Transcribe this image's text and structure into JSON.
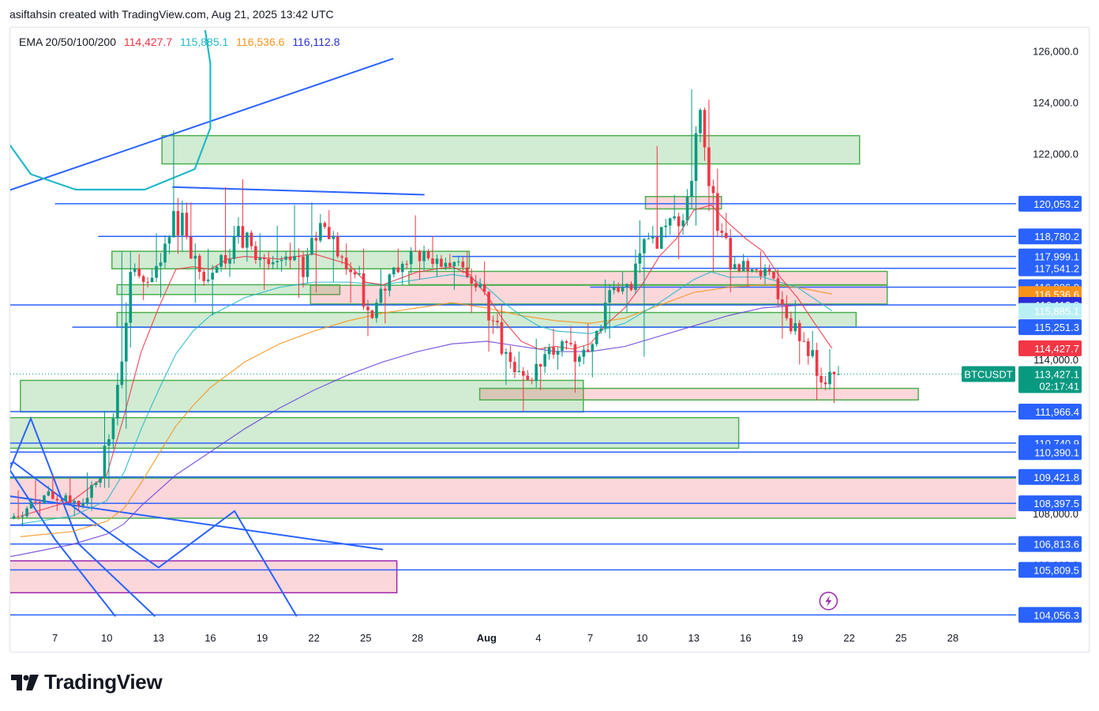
{
  "header": {
    "attribution": "asiftahsin created with TradingView.com, Aug 21, 2025 13:42 UTC"
  },
  "ema": {
    "label": "EMA 20/50/100/200",
    "values": [
      {
        "name": "EMA 20",
        "value": "114,427.7",
        "color": "#f23645"
      },
      {
        "name": "EMA 50",
        "value": "115,885.1",
        "color": "#22b8c8"
      },
      {
        "name": "EMA 100",
        "value": "116,536.6",
        "color": "#f7931a"
      },
      {
        "name": "EMA 200",
        "value": "116,112.8",
        "color": "#2a2ed6"
      }
    ]
  },
  "brand": {
    "name": "TradingView"
  },
  "chart_data": {
    "type": "candlestick",
    "symbol": "BTCUSDT",
    "countdown": "02:17:41",
    "last_price": 113427.1,
    "ylim": [
      103700,
      126900
    ],
    "x_ticks": [
      {
        "label": "7",
        "day": 7
      },
      {
        "label": "10",
        "day": 10
      },
      {
        "label": "13",
        "day": 13
      },
      {
        "label": "16",
        "day": 16
      },
      {
        "label": "19",
        "day": 19
      },
      {
        "label": "22",
        "day": 22
      },
      {
        "label": "25",
        "day": 25
      },
      {
        "label": "28",
        "day": 28
      },
      {
        "label": "Aug",
        "day": 32
      },
      {
        "label": "4",
        "day": 35
      },
      {
        "label": "7",
        "day": 38
      },
      {
        "label": "10",
        "day": 41
      },
      {
        "label": "13",
        "day": 44
      },
      {
        "label": "16",
        "day": 47
      },
      {
        "label": "19",
        "day": 50
      },
      {
        "label": "22",
        "day": 53
      },
      {
        "label": "25",
        "day": 56
      },
      {
        "label": "28",
        "day": 59
      }
    ],
    "y_ticks": [
      {
        "value": 126000,
        "label": "126,000.0"
      },
      {
        "value": 124000,
        "label": "124,000.0"
      },
      {
        "value": 122000,
        "label": "122,000.0"
      },
      {
        "value": 114000,
        "label": "114,000.0"
      },
      {
        "value": 108000,
        "label": "108,000.0"
      },
      {
        "value": 106000,
        "label": "106,000.0"
      }
    ],
    "price_levels": [
      {
        "value": 120053.2,
        "label": "120,053.2",
        "start_day": 7
      },
      {
        "value": 118780.2,
        "label": "118,780.2",
        "start_day": 9.5
      },
      {
        "value": 117999.1,
        "label": "117,999.1",
        "start_day": 30
      },
      {
        "value": 117541.2,
        "label": "117,541.2",
        "start_day": 41
      },
      {
        "value": 116806.0,
        "label": "116,806.0",
        "start_day": 38
      },
      {
        "value": 116112.8,
        "label": "116,112.8",
        "start_day": 3
      },
      {
        "value": 115251.3,
        "label": "115,251.3",
        "start_day": 8
      },
      {
        "value": 111966.4,
        "label": "111,966.4",
        "start_day": 4
      },
      {
        "value": 110740.9,
        "label": "110,740.9",
        "start_day": 1
      },
      {
        "value": 110390.1,
        "label": "110,390.1",
        "start_day": 1
      },
      {
        "value": 109421.8,
        "label": "109,421.8",
        "start_day": 1
      },
      {
        "value": 108397.5,
        "label": "108,397.5",
        "start_day": 1
      },
      {
        "value": 106813.6,
        "label": "106,813.6",
        "start_day": 1
      },
      {
        "value": 105809.5,
        "label": "105,809.5",
        "start_day": 1
      },
      {
        "value": 104056.3,
        "label": "104,056.3",
        "start_day": 1
      }
    ],
    "tags": [
      {
        "value": 116536.6,
        "label": "116,536.6",
        "color": "#f7931a"
      },
      {
        "value": 116112.8,
        "label": "116,112.8",
        "color": "#2a2ed6"
      },
      {
        "value": 115885.1,
        "label": "115,885.1",
        "color": "#b9f0f5",
        "text": "#131722"
      },
      {
        "value": 114427.7,
        "label": "114,427.7",
        "color": "#f23645"
      }
    ],
    "zones": [
      {
        "x0": 13.2,
        "x1": 53.6,
        "y0": 121600,
        "y1": 122700,
        "type": "demand"
      },
      {
        "x0": 10.3,
        "x1": 31.0,
        "y0": 117520,
        "y1": 118200,
        "type": "demand"
      },
      {
        "x0": 41.2,
        "x1": 45.6,
        "y0": 119850,
        "y1": 120330,
        "type": "supply"
      },
      {
        "x0": 27.5,
        "x1": 55.2,
        "y0": 116900,
        "y1": 117420,
        "type": "supply"
      },
      {
        "x0": 10.6,
        "x1": 23.5,
        "y0": 116520,
        "y1": 116900,
        "type": "demand"
      },
      {
        "x0": 21.8,
        "x1": 55.2,
        "y0": 116150,
        "y1": 116880,
        "type": "supply"
      },
      {
        "x0": 10.6,
        "x1": 53.4,
        "y0": 115250,
        "y1": 115820,
        "type": "demand"
      },
      {
        "x0": 5.0,
        "x1": 37.6,
        "y0": 111950,
        "y1": 113180,
        "type": "demand"
      },
      {
        "x0": 31.6,
        "x1": 57.0,
        "y0": 112420,
        "y1": 112870,
        "type": "supply"
      },
      {
        "x0": 1.0,
        "x1": 46.6,
        "y0": 110540,
        "y1": 111730,
        "type": "demand"
      },
      {
        "x0": 1.4,
        "x1": 64.5,
        "y0": 107820,
        "y1": 109380,
        "type": "supply"
      },
      {
        "x0": 1.0,
        "x1": 26.8,
        "y0": 104920,
        "y1": 106160,
        "type": "supply-purple"
      }
    ],
    "ohlc_days": [
      [
        5,
        107800,
        108900,
        107500,
        108200
      ],
      [
        6,
        108200,
        109300,
        107900,
        108700
      ],
      [
        7,
        108700,
        109500,
        108100,
        108500
      ],
      [
        8,
        108500,
        109400,
        107900,
        108300
      ],
      [
        9,
        108300,
        109600,
        108100,
        109200
      ],
      [
        10,
        109200,
        112000,
        109000,
        111700
      ],
      [
        11,
        111700,
        118200,
        111300,
        117400
      ],
      [
        12,
        117400,
        118100,
        116300,
        117000
      ],
      [
        13,
        117000,
        118900,
        116400,
        118500
      ],
      [
        14,
        118500,
        122900,
        118100,
        119700
      ],
      [
        15,
        119700,
        120100,
        116200,
        117400
      ],
      [
        16,
        117400,
        118300,
        115700,
        117600
      ],
      [
        17,
        117600,
        120700,
        117200,
        118800
      ],
      [
        18,
        118800,
        121000,
        117800,
        118400
      ],
      [
        19,
        118400,
        118900,
        116700,
        117700
      ],
      [
        20,
        117700,
        119200,
        117400,
        118000
      ],
      [
        21,
        118000,
        120000,
        116400,
        117200
      ],
      [
        22,
        117200,
        120100,
        116600,
        119300
      ],
      [
        23,
        119300,
        119800,
        117000,
        118000
      ],
      [
        24,
        118000,
        118500,
        116200,
        117300
      ],
      [
        25,
        117300,
        118300,
        114900,
        115600
      ],
      [
        26,
        115600,
        117500,
        115400,
        117300
      ],
      [
        27,
        117300,
        118300,
        116900,
        117700
      ],
      [
        28,
        117700,
        119600,
        117100,
        118200
      ],
      [
        29,
        118200,
        118800,
        117200,
        117600
      ],
      [
        30,
        117600,
        118100,
        116700,
        117800
      ],
      [
        31,
        117800,
        118200,
        115800,
        116800
      ],
      [
        32,
        116800,
        117800,
        114300,
        115500
      ],
      [
        33,
        115500,
        116100,
        113000,
        113900
      ],
      [
        34,
        113900,
        114300,
        112000,
        113200
      ],
      [
        35,
        113200,
        114800,
        112800,
        114200
      ],
      [
        36,
        114200,
        115200,
        113600,
        114700
      ],
      [
        37,
        114700,
        115300,
        112700,
        114100
      ],
      [
        38,
        114100,
        115400,
        113300,
        115100
      ],
      [
        39,
        115100,
        117100,
        114800,
        116800
      ],
      [
        40,
        116800,
        117400,
        115800,
        116700
      ],
      [
        41,
        116700,
        119400,
        114100,
        118700
      ],
      [
        42,
        118700,
        122300,
        118300,
        119200
      ],
      [
        43,
        119200,
        120400,
        117900,
        119400
      ],
      [
        44,
        119400,
        124500,
        119200,
        123700
      ],
      [
        45,
        123700,
        124100,
        117400,
        119000
      ],
      [
        46,
        119000,
        119700,
        116600,
        117700
      ],
      [
        47,
        117700,
        118100,
        116800,
        117500
      ],
      [
        48,
        117500,
        118200,
        116900,
        117400
      ],
      [
        49,
        117400,
        117500,
        114800,
        115600
      ],
      [
        50,
        115600,
        116300,
        113800,
        114700
      ],
      [
        51,
        114700,
        115100,
        112400,
        113100
      ],
      [
        52,
        113100,
        114400,
        112300,
        113427.1
      ]
    ],
    "trendlines": [
      {
        "points": [
          [
            1.0,
            119800
          ],
          [
            26.6,
            125700
          ]
        ],
        "color": "#2962ff"
      },
      {
        "points": [
          [
            13.8,
            120700
          ],
          [
            28.4,
            120400
          ]
        ],
        "color": "#2962ff"
      },
      {
        "points": [
          [
            1.0,
            109000
          ],
          [
            26.0,
            106600
          ]
        ],
        "color": "#2962ff"
      },
      {
        "points": [
          [
            1.0,
            107550
          ],
          [
            9.4,
            107550
          ]
        ],
        "color": "#2962ff"
      },
      {
        "points": [
          [
            1.5,
            109000
          ],
          [
            4.6,
            110000
          ],
          [
            9.4,
            107600
          ],
          [
            13.0,
            105900
          ],
          [
            17.4,
            108100
          ],
          [
            21.0,
            104000
          ]
        ],
        "color": "#2962ff"
      },
      {
        "points": [
          [
            3.4,
            108100
          ],
          [
            5.6,
            111700
          ],
          [
            8.4,
            106800
          ],
          [
            12.8,
            104000
          ]
        ],
        "color": "#2962ff"
      },
      {
        "points": [
          [
            2.4,
            108500
          ],
          [
            3.8,
            110300
          ],
          [
            7.0,
            107000
          ],
          [
            10.5,
            104000
          ]
        ],
        "color": "#2962ff"
      }
    ],
    "ema20": [
      [
        5,
        107900
      ],
      [
        8,
        108500
      ],
      [
        10,
        109500
      ],
      [
        11,
        111800
      ],
      [
        12,
        114300
      ],
      [
        13,
        116000
      ],
      [
        14,
        117500
      ],
      [
        15,
        117600
      ],
      [
        16,
        117500
      ],
      [
        17,
        117900
      ],
      [
        18,
        118000
      ],
      [
        20,
        117900
      ],
      [
        22,
        118100
      ],
      [
        24,
        117700
      ],
      [
        25,
        117000
      ],
      [
        26,
        116900
      ],
      [
        28,
        117400
      ],
      [
        30,
        117600
      ],
      [
        31,
        117300
      ],
      [
        32,
        116500
      ],
      [
        33,
        115500
      ],
      [
        34,
        114700
      ],
      [
        35,
        114400
      ],
      [
        36,
        114500
      ],
      [
        37,
        114400
      ],
      [
        38,
        114600
      ],
      [
        39,
        115400
      ],
      [
        40,
        116000
      ],
      [
        41,
        116900
      ],
      [
        42,
        118000
      ],
      [
        43,
        118700
      ],
      [
        44,
        119800
      ],
      [
        45,
        120000
      ],
      [
        46,
        119300
      ],
      [
        47,
        118700
      ],
      [
        48,
        118200
      ],
      [
        49,
        117200
      ],
      [
        50,
        116400
      ],
      [
        51,
        115400
      ],
      [
        52,
        114427.7
      ]
    ],
    "ema50": [
      [
        5,
        107600
      ],
      [
        8,
        107900
      ],
      [
        10,
        108500
      ],
      [
        11,
        109600
      ],
      [
        12,
        111300
      ],
      [
        13,
        112800
      ],
      [
        14,
        114200
      ],
      [
        15,
        115100
      ],
      [
        16,
        115700
      ],
      [
        18,
        116400
      ],
      [
        20,
        116800
      ],
      [
        22,
        117000
      ],
      [
        24,
        117000
      ],
      [
        26,
        116900
      ],
      [
        28,
        117100
      ],
      [
        30,
        117300
      ],
      [
        31,
        117200
      ],
      [
        32,
        116800
      ],
      [
        33,
        116200
      ],
      [
        34,
        115700
      ],
      [
        35,
        115300
      ],
      [
        36,
        115100
      ],
      [
        38,
        115000
      ],
      [
        40,
        115400
      ],
      [
        42,
        116200
      ],
      [
        44,
        117100
      ],
      [
        45,
        117400
      ],
      [
        46,
        117200
      ],
      [
        48,
        117200
      ],
      [
        50,
        116800
      ],
      [
        52,
        115885.1
      ]
    ],
    "ema100": [
      [
        5,
        107100
      ],
      [
        8,
        107300
      ],
      [
        10,
        107700
      ],
      [
        11,
        108200
      ],
      [
        12,
        109200
      ],
      [
        13,
        110300
      ],
      [
        14,
        111400
      ],
      [
        15,
        112200
      ],
      [
        16,
        112900
      ],
      [
        18,
        113900
      ],
      [
        20,
        114600
      ],
      [
        22,
        115100
      ],
      [
        24,
        115500
      ],
      [
        26,
        115800
      ],
      [
        28,
        116000
      ],
      [
        30,
        116200
      ],
      [
        32,
        116000
      ],
      [
        34,
        115700
      ],
      [
        36,
        115500
      ],
      [
        38,
        115400
      ],
      [
        40,
        115600
      ],
      [
        42,
        116100
      ],
      [
        44,
        116600
      ],
      [
        46,
        116800
      ],
      [
        48,
        116900
      ],
      [
        50,
        116800
      ],
      [
        52,
        116536.6
      ]
    ],
    "ema200": [
      [
        1,
        105900
      ],
      [
        5,
        106400
      ],
      [
        8,
        106800
      ],
      [
        10,
        107200
      ],
      [
        11,
        107600
      ],
      [
        12,
        108300
      ],
      [
        13,
        108900
      ],
      [
        14,
        109500
      ],
      [
        16,
        110400
      ],
      [
        18,
        111300
      ],
      [
        20,
        112100
      ],
      [
        22,
        112800
      ],
      [
        24,
        113400
      ],
      [
        26,
        113900
      ],
      [
        28,
        114300
      ],
      [
        30,
        114600
      ],
      [
        32,
        114700
      ],
      [
        34,
        114500
      ],
      [
        36,
        114300
      ],
      [
        38,
        114300
      ],
      [
        40,
        114500
      ],
      [
        42,
        114900
      ],
      [
        44,
        115300
      ],
      [
        46,
        115700
      ],
      [
        48,
        116000
      ],
      [
        50,
        116100
      ],
      [
        52,
        116112.8
      ]
    ]
  }
}
